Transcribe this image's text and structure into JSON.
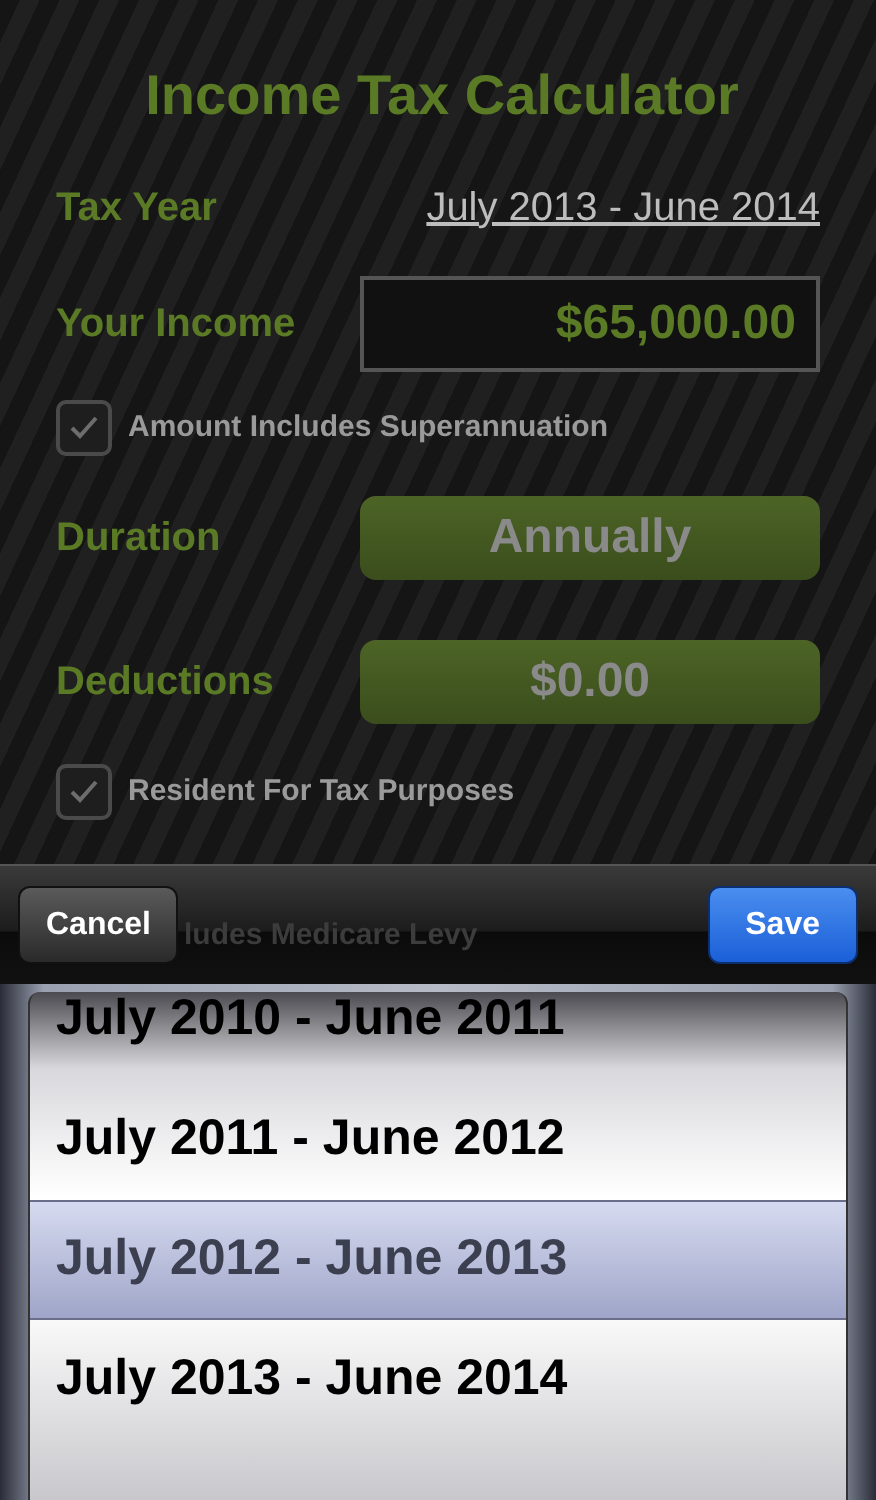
{
  "title": "Income Tax Calculator",
  "tax_year": {
    "label": "Tax Year",
    "value": "July 2013 - June 2014"
  },
  "income": {
    "label": "Your Income",
    "value": "$65,000.00"
  },
  "checkboxes": [
    {
      "label": "Amount Includes Superannuation",
      "checked": true
    },
    {
      "label": "Resident For Tax Purposes",
      "checked": true
    }
  ],
  "duration": {
    "label": "Duration",
    "value": "Annually"
  },
  "deductions": {
    "label": "Deductions",
    "value": "$0.00"
  },
  "obscured_option": {
    "label": "ludes Medicare Levy"
  },
  "toolbar": {
    "cancel": "Cancel",
    "save": "Save"
  },
  "picker": [
    {
      "label": "July 2010 - June 2011",
      "selected": false
    },
    {
      "label": "July 2011 - June 2012",
      "selected": false
    },
    {
      "label": "July 2012 - June 2013",
      "selected": true
    },
    {
      "label": "July 2013 - June 2014",
      "selected": false
    }
  ]
}
